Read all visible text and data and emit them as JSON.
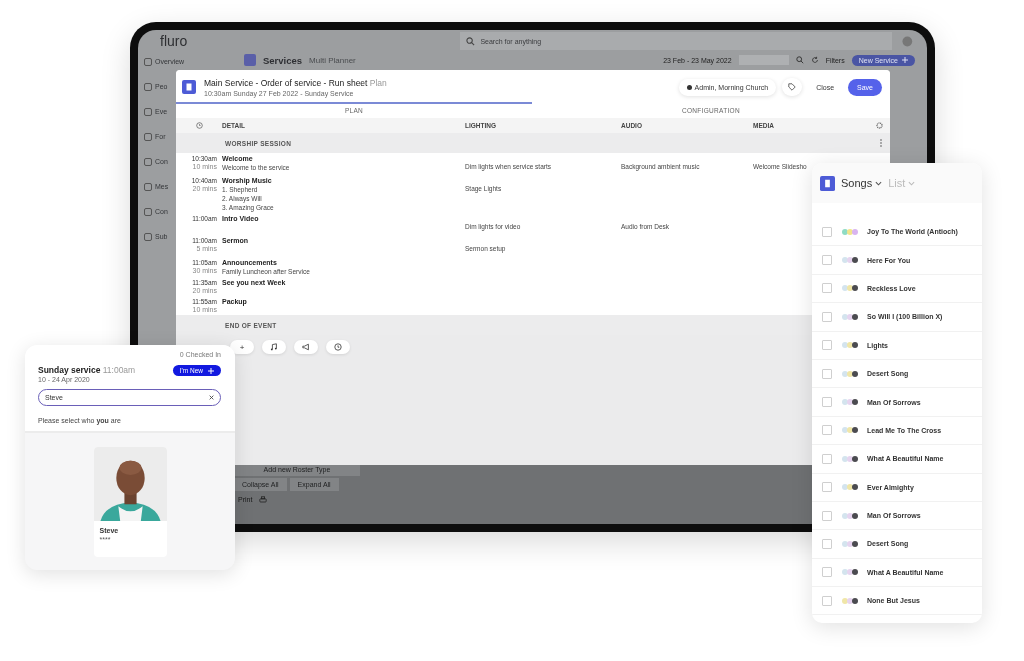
{
  "app": {
    "logo": "fluro",
    "search_placeholder": "Search for anything",
    "sidebar": [
      "Overview",
      "Peo",
      "Eve",
      "For",
      "Con",
      "Mes",
      "Con",
      "Sub"
    ],
    "page_title": "Services",
    "view": "Multi Planner",
    "date_range": "23 Feb - 23 May 2022",
    "filters": "Filters",
    "new_button": "New Service",
    "footer_buttons": [
      "Add new Roster Type",
      "Collapse All",
      "Expand All"
    ],
    "print": "Print"
  },
  "run_sheet": {
    "title": "Main Service - Order of service - Run sheet",
    "title_suffix": "Plan",
    "subtitle": "10:30am Sunday 27 Feb 2022 - Sunday Service",
    "owner": "Admin, Morning Church",
    "close": "Close",
    "save": "Save",
    "tabs": [
      {
        "label": "PLAN",
        "selected": true
      },
      {
        "label": "CONFIGURATION",
        "selected": false
      }
    ],
    "columns": [
      "DETAIL",
      "LIGHTING",
      "AUDIO",
      "MEDIA"
    ],
    "sections": [
      {
        "kind": "header",
        "label": "WORSHIP SESSION"
      },
      {
        "kind": "item",
        "time": "10:30am",
        "duration": "10 mins",
        "title": "Welcome",
        "notes": [
          "Welcome to the service"
        ],
        "lighting": "Dim lights when service starts",
        "audio": "Background ambient music",
        "media": "Welcome Slidesho"
      },
      {
        "kind": "item",
        "time": "10:40am",
        "duration": "20 mins",
        "title": "Worship Music",
        "notes": [
          "1. Shepherd",
          "2. Always Will",
          "3. Amazing Grace"
        ],
        "lighting": "Stage Lights"
      },
      {
        "kind": "item",
        "time": "11:00am",
        "title": "Intro Video",
        "lighting": "Dim lights for video",
        "audio": "Audio from Desk"
      },
      {
        "kind": "item",
        "time": "11:00am",
        "duration": "5 mins",
        "title": "Sermon",
        "lighting": "Sermon setup"
      },
      {
        "kind": "item",
        "time": "11:05am",
        "duration": "30 mins",
        "title": "Announcements",
        "notes": [
          "Family Luncheon after Service"
        ]
      },
      {
        "kind": "item",
        "time": "11:35am",
        "duration": "20 mins",
        "title": "See you next Week"
      },
      {
        "kind": "item",
        "time": "11:55am",
        "duration": "10 mins",
        "title": "Packup"
      },
      {
        "kind": "header",
        "label": "END OF EVENT"
      }
    ],
    "tools": [
      {
        "kind": "add",
        "label": "+"
      },
      {
        "kind": "music"
      },
      {
        "kind": "megaphone"
      },
      {
        "kind": "clock"
      }
    ]
  },
  "checkin": {
    "count": "0 Checked In",
    "title": "Sunday service",
    "time": "11:00am",
    "date": "10 - 24 Apr 2020",
    "new_button": "I'm New",
    "search_value": "Steve",
    "prompt": "Please select who **you** are",
    "person": {
      "name": "Steve",
      "detail": "****"
    }
  },
  "songs": {
    "title": "Songs",
    "view": "List",
    "items": [
      {
        "title": "Joy To The World (Antioch)",
        "checked": false,
        "dots": [
          {
            "color": "#8fdcc4"
          },
          {
            "color": "#f2e48a"
          },
          {
            "color": "#d8b4f0"
          }
        ]
      },
      {
        "title": "Here For You",
        "checked": false,
        "dots": [
          {
            "color": "#d4e4ee"
          },
          {
            "color": "#e6d4ef"
          },
          {
            "color": "#4b4b50"
          }
        ]
      },
      {
        "title": "Reckless Love",
        "checked": false,
        "dots": [
          {
            "color": "#d4e4ee"
          },
          {
            "color": "#f0e6a8"
          },
          {
            "color": "#4b4b50"
          }
        ]
      },
      {
        "title": "So Will I (100 Billion X)",
        "checked": false,
        "dots": [
          {
            "color": "#d4e4ee"
          },
          {
            "color": "#e6d4ef"
          },
          {
            "color": "#4b4b50"
          }
        ]
      },
      {
        "title": "Lights",
        "checked": false,
        "dots": [
          {
            "color": "#d4e4ee"
          },
          {
            "color": "#f0e6a8"
          },
          {
            "color": "#4b4b50"
          }
        ]
      },
      {
        "title": "Desert Song",
        "checked": false,
        "dots": [
          {
            "color": "#d4e4ee"
          },
          {
            "color": "#f0e6a8"
          },
          {
            "color": "#4b4b50"
          }
        ]
      },
      {
        "title": "Man Of Sorrows",
        "checked": false,
        "dots": [
          {
            "color": "#d4e4ee"
          },
          {
            "color": "#e6d4ef"
          },
          {
            "color": "#4b4b50"
          }
        ]
      },
      {
        "title": "Lead Me To The Cross",
        "checked": false,
        "dots": [
          {
            "color": "#d4e4ee"
          },
          {
            "color": "#f0e6a8"
          },
          {
            "color": "#4b4b50"
          }
        ]
      },
      {
        "title": "What A Beautiful Name",
        "checked": false,
        "dots": [
          {
            "color": "#d4e4ee"
          },
          {
            "color": "#e6d4ef"
          },
          {
            "color": "#4b4b50"
          }
        ]
      },
      {
        "title": "Ever Almighty",
        "checked": false,
        "dots": [
          {
            "color": "#d4e4ee"
          },
          {
            "color": "#f0e6a8"
          },
          {
            "color": "#4b4b50"
          }
        ]
      },
      {
        "title": "Man Of Sorrows",
        "checked": false,
        "dots": [
          {
            "color": "#d4e4ee"
          },
          {
            "color": "#e6d4ef"
          },
          {
            "color": "#4b4b50"
          }
        ]
      },
      {
        "title": "Desert Song",
        "checked": false,
        "dots": [
          {
            "color": "#d4e4ee"
          },
          {
            "color": "#e6d4ef"
          },
          {
            "color": "#4b4b50"
          }
        ]
      },
      {
        "title": "What A Beautiful Name",
        "checked": false,
        "dots": [
          {
            "color": "#d4e4ee"
          },
          {
            "color": "#e6d4ef"
          },
          {
            "color": "#4b4b50"
          }
        ]
      },
      {
        "title": "None But Jesus",
        "checked": false,
        "dots": [
          {
            "color": "#f0e6a8"
          },
          {
            "color": "#e6d4ef"
          },
          {
            "color": "#4b4b50"
          }
        ]
      }
    ]
  }
}
